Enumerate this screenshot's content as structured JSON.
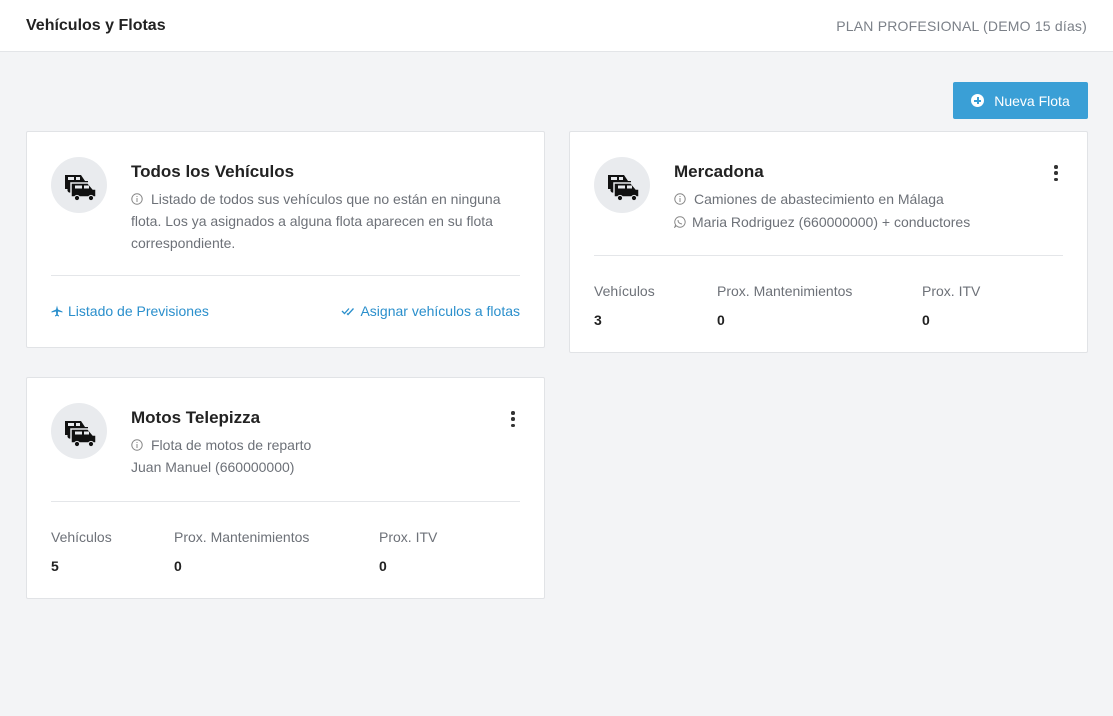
{
  "header": {
    "title": "Vehículos y Flotas",
    "plan": "PLAN PROFESIONAL (DEMO 15 días)"
  },
  "actions": {
    "new_fleet_label": "Nueva Flota"
  },
  "cards": {
    "all": {
      "title": "Todos los Vehículos",
      "description": "Listado de todos sus vehículos que no están en ninguna flota. Los ya asignados a alguna flota aparecen en su flota correspondiente.",
      "link_forecasts": "Listado de Previsiones",
      "link_assign": "Asignar vehículos a flotas"
    },
    "mercadona": {
      "title": "Mercadona",
      "description": "Camiones de abastecimiento en Málaga",
      "contact": "Maria Rodriguez (660000000) + conductores",
      "stats": {
        "vehicles_label": "Vehículos",
        "vehicles_value": "3",
        "maint_label": "Prox. Mantenimientos",
        "maint_value": "0",
        "itv_label": "Prox. ITV",
        "itv_value": "0"
      }
    },
    "motos": {
      "title": "Motos Telepizza",
      "description": "Flota de motos de reparto",
      "contact": "Juan Manuel (660000000)",
      "stats": {
        "vehicles_label": "Vehículos",
        "vehicles_value": "5",
        "maint_label": "Prox. Mantenimientos",
        "maint_value": "0",
        "itv_label": "Prox. ITV",
        "itv_value": "0"
      }
    }
  },
  "colors": {
    "accent": "#3a9fd6",
    "link": "#2a8fcc",
    "background": "#f3f4f6"
  },
  "icons": [
    "plus-circle-icon",
    "vehicles-icon",
    "info-icon",
    "whatsapp-icon",
    "plane-icon",
    "check-double-icon",
    "more-vertical-icon"
  ]
}
